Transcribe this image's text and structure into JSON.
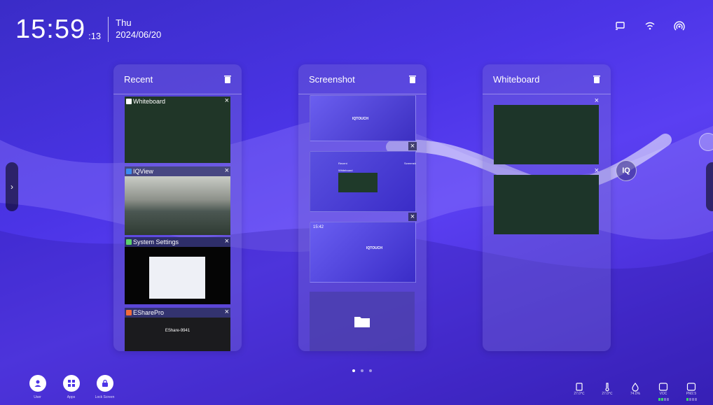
{
  "clock": {
    "time": "15:59",
    "seconds": ":13",
    "weekday": "Thu",
    "date": "2024/06/20"
  },
  "status_icons": [
    "cast-icon",
    "wifi-icon",
    "hotspot-icon"
  ],
  "panels": [
    {
      "title": "Recent",
      "cards": [
        {
          "label": "Whiteboard",
          "icon": "whiteboard-icon"
        },
        {
          "label": "IQView",
          "icon": "camera-icon"
        },
        {
          "label": "System Settings",
          "icon": "settings-icon"
        },
        {
          "label": "ESharePro",
          "icon": "eshare-icon"
        }
      ]
    },
    {
      "title": "Screenshot",
      "thumbnails": [
        {
          "text": "IQTOUCH"
        },
        {
          "text": "Recent",
          "text2": "Whiteboard",
          "text3": "Screensh"
        },
        {
          "text": "15:42",
          "text2": "IQTOUCH"
        }
      ]
    },
    {
      "title": "Whiteboard",
      "items": 2
    }
  ],
  "eshare": {
    "name": "EShare-9941"
  },
  "dock": [
    {
      "label": "User",
      "icon": "user-icon"
    },
    {
      "label": "Apps",
      "icon": "apps-icon"
    },
    {
      "label": "Lock Screen",
      "icon": "lock-icon"
    }
  ],
  "sensors": [
    {
      "label": "27.0℃",
      "icon": "temperature-icon"
    },
    {
      "label": "27.0℃",
      "icon": "thermometer-icon"
    },
    {
      "label": "74.0%",
      "icon": "humidity-icon"
    },
    {
      "label": "VOC",
      "icon": "voc-icon",
      "level": 2
    },
    {
      "label": "PM2.5",
      "icon": "pm25-icon",
      "level": 1
    }
  ],
  "colors": {
    "accent": "#4b34e6",
    "whiteboard_bg": "#1d3529",
    "meter_green": "#3bd16f"
  },
  "pager": {
    "pages": 3,
    "current": 1
  }
}
